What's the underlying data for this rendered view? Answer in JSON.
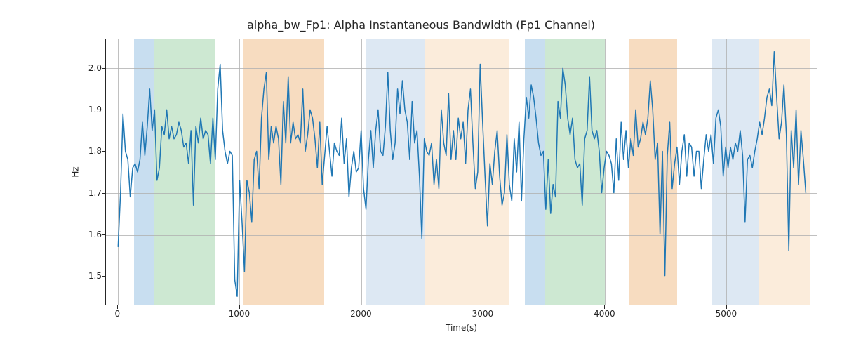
{
  "chart_data": {
    "type": "line",
    "title": "alpha_bw_Fp1: Alpha Instantaneous Bandwidth (Fp1 Channel)",
    "xlabel": "Time(s)",
    "ylabel": "Hz",
    "xlim": [
      -100,
      5750
    ],
    "ylim": [
      1.43,
      2.07
    ],
    "xticks": [
      0,
      1000,
      2000,
      3000,
      4000,
      5000
    ],
    "yticks": [
      1.5,
      1.6,
      1.7,
      1.8,
      1.9,
      2.0
    ],
    "grid": true,
    "bands": [
      {
        "x0": 130,
        "x1": 290,
        "color": "#c8def0"
      },
      {
        "x0": 290,
        "x1": 800,
        "color": "#cde8d2"
      },
      {
        "x0": 1030,
        "x1": 1690,
        "color": "#f7dcc0"
      },
      {
        "x0": 2040,
        "x1": 2520,
        "color": "#dde8f3"
      },
      {
        "x0": 2520,
        "x1": 3210,
        "color": "#fbecdb"
      },
      {
        "x0": 3340,
        "x1": 3510,
        "color": "#c8def0"
      },
      {
        "x0": 3510,
        "x1": 4000,
        "color": "#cde8d2"
      },
      {
        "x0": 4200,
        "x1": 4590,
        "color": "#f7dcc0"
      },
      {
        "x0": 4880,
        "x1": 5260,
        "color": "#dde8f3"
      },
      {
        "x0": 5260,
        "x1": 5680,
        "color": "#fbecdb"
      }
    ],
    "x": [
      0,
      20,
      40,
      60,
      80,
      100,
      120,
      140,
      160,
      180,
      200,
      220,
      240,
      260,
      280,
      300,
      320,
      340,
      360,
      380,
      400,
      420,
      440,
      460,
      480,
      500,
      520,
      540,
      560,
      580,
      600,
      620,
      640,
      660,
      680,
      700,
      720,
      740,
      760,
      780,
      800,
      820,
      840,
      860,
      880,
      900,
      920,
      940,
      960,
      980,
      1000,
      1020,
      1040,
      1060,
      1080,
      1100,
      1120,
      1140,
      1160,
      1180,
      1200,
      1220,
      1240,
      1260,
      1280,
      1300,
      1320,
      1340,
      1360,
      1380,
      1400,
      1420,
      1440,
      1460,
      1480,
      1500,
      1520,
      1540,
      1560,
      1580,
      1600,
      1620,
      1640,
      1660,
      1680,
      1700,
      1720,
      1740,
      1760,
      1780,
      1800,
      1820,
      1840,
      1860,
      1880,
      1900,
      1920,
      1940,
      1960,
      1980,
      2000,
      2020,
      2040,
      2060,
      2080,
      2100,
      2120,
      2140,
      2160,
      2180,
      2200,
      2220,
      2240,
      2260,
      2280,
      2300,
      2320,
      2340,
      2360,
      2380,
      2400,
      2420,
      2440,
      2460,
      2480,
      2500,
      2520,
      2540,
      2560,
      2580,
      2600,
      2620,
      2640,
      2660,
      2680,
      2700,
      2720,
      2740,
      2760,
      2780,
      2800,
      2820,
      2840,
      2860,
      2880,
      2900,
      2920,
      2940,
      2960,
      2980,
      3000,
      3020,
      3040,
      3060,
      3080,
      3100,
      3120,
      3140,
      3160,
      3180,
      3200,
      3220,
      3240,
      3260,
      3280,
      3300,
      3320,
      3340,
      3360,
      3380,
      3400,
      3420,
      3440,
      3460,
      3480,
      3500,
      3520,
      3540,
      3560,
      3580,
      3600,
      3620,
      3640,
      3660,
      3680,
      3700,
      3720,
      3740,
      3760,
      3780,
      3800,
      3820,
      3840,
      3860,
      3880,
      3900,
      3920,
      3940,
      3960,
      3980,
      4000,
      4020,
      4040,
      4060,
      4080,
      4100,
      4120,
      4140,
      4160,
      4180,
      4200,
      4220,
      4240,
      4260,
      4280,
      4300,
      4320,
      4340,
      4360,
      4380,
      4400,
      4420,
      4440,
      4460,
      4480,
      4500,
      4520,
      4540,
      4560,
      4580,
      4600,
      4620,
      4640,
      4660,
      4680,
      4700,
      4720,
      4740,
      4760,
      4780,
      4800,
      4820,
      4840,
      4860,
      4880,
      4900,
      4920,
      4940,
      4960,
      4980,
      5000,
      5020,
      5040,
      5060,
      5080,
      5100,
      5120,
      5140,
      5160,
      5180,
      5200,
      5220,
      5240,
      5260,
      5280,
      5300,
      5320,
      5340,
      5360,
      5380,
      5400,
      5420,
      5440,
      5460,
      5480,
      5500,
      5520,
      5540,
      5560,
      5580,
      5600,
      5620,
      5640,
      5660
    ],
    "y": [
      1.57,
      1.7,
      1.89,
      1.8,
      1.78,
      1.69,
      1.76,
      1.77,
      1.75,
      1.78,
      1.87,
      1.79,
      1.86,
      1.95,
      1.85,
      1.9,
      1.73,
      1.76,
      1.86,
      1.84,
      1.9,
      1.83,
      1.86,
      1.83,
      1.84,
      1.87,
      1.85,
      1.81,
      1.82,
      1.77,
      1.85,
      1.67,
      1.86,
      1.82,
      1.88,
      1.83,
      1.85,
      1.84,
      1.77,
      1.88,
      1.78,
      1.95,
      2.01,
      1.85,
      1.8,
      1.77,
      1.8,
      1.79,
      1.49,
      1.45,
      1.73,
      1.63,
      1.51,
      1.73,
      1.7,
      1.63,
      1.78,
      1.8,
      1.71,
      1.88,
      1.95,
      1.99,
      1.78,
      1.86,
      1.82,
      1.86,
      1.83,
      1.72,
      1.92,
      1.82,
      1.98,
      1.82,
      1.87,
      1.83,
      1.84,
      1.82,
      1.95,
      1.8,
      1.84,
      1.9,
      1.88,
      1.83,
      1.76,
      1.87,
      1.72,
      1.79,
      1.86,
      1.8,
      1.74,
      1.82,
      1.8,
      1.79,
      1.88,
      1.77,
      1.83,
      1.69,
      1.76,
      1.8,
      1.75,
      1.76,
      1.85,
      1.71,
      1.66,
      1.78,
      1.85,
      1.76,
      1.85,
      1.9,
      1.8,
      1.79,
      1.86,
      1.99,
      1.85,
      1.78,
      1.82,
      1.95,
      1.89,
      1.97,
      1.9,
      1.87,
      1.78,
      1.92,
      1.82,
      1.85,
      1.74,
      1.59,
      1.83,
      1.8,
      1.79,
      1.82,
      1.72,
      1.78,
      1.71,
      1.9,
      1.82,
      1.79,
      1.94,
      1.78,
      1.85,
      1.78,
      1.88,
      1.83,
      1.87,
      1.77,
      1.9,
      1.95,
      1.82,
      1.71,
      1.75,
      2.01,
      1.87,
      1.74,
      1.62,
      1.77,
      1.72,
      1.8,
      1.85,
      1.74,
      1.67,
      1.7,
      1.84,
      1.72,
      1.68,
      1.83,
      1.75,
      1.87,
      1.68,
      1.83,
      1.93,
      1.88,
      1.96,
      1.93,
      1.88,
      1.82,
      1.79,
      1.8,
      1.66,
      1.78,
      1.65,
      1.72,
      1.69,
      1.92,
      1.88,
      2.0,
      1.96,
      1.88,
      1.84,
      1.88,
      1.78,
      1.76,
      1.77,
      1.67,
      1.83,
      1.85,
      1.98,
      1.85,
      1.83,
      1.85,
      1.8,
      1.7,
      1.76,
      1.8,
      1.79,
      1.77,
      1.7,
      1.83,
      1.73,
      1.87,
      1.78,
      1.85,
      1.76,
      1.83,
      1.79,
      1.9,
      1.81,
      1.83,
      1.87,
      1.84,
      1.88,
      1.97,
      1.9,
      1.78,
      1.82,
      1.6,
      1.8,
      1.5,
      1.79,
      1.87,
      1.71,
      1.77,
      1.81,
      1.72,
      1.8,
      1.84,
      1.74,
      1.82,
      1.81,
      1.74,
      1.8,
      1.8,
      1.71,
      1.78,
      1.84,
      1.8,
      1.84,
      1.77,
      1.88,
      1.9,
      1.86,
      1.74,
      1.81,
      1.76,
      1.81,
      1.78,
      1.82,
      1.8,
      1.85,
      1.79,
      1.63,
      1.78,
      1.79,
      1.76,
      1.8,
      1.83,
      1.87,
      1.84,
      1.88,
      1.93,
      1.95,
      1.91,
      2.04,
      1.93,
      1.83,
      1.87,
      1.96,
      1.84,
      1.56,
      1.85,
      1.76,
      1.9,
      1.72,
      1.85,
      1.78,
      1.7
    ]
  }
}
